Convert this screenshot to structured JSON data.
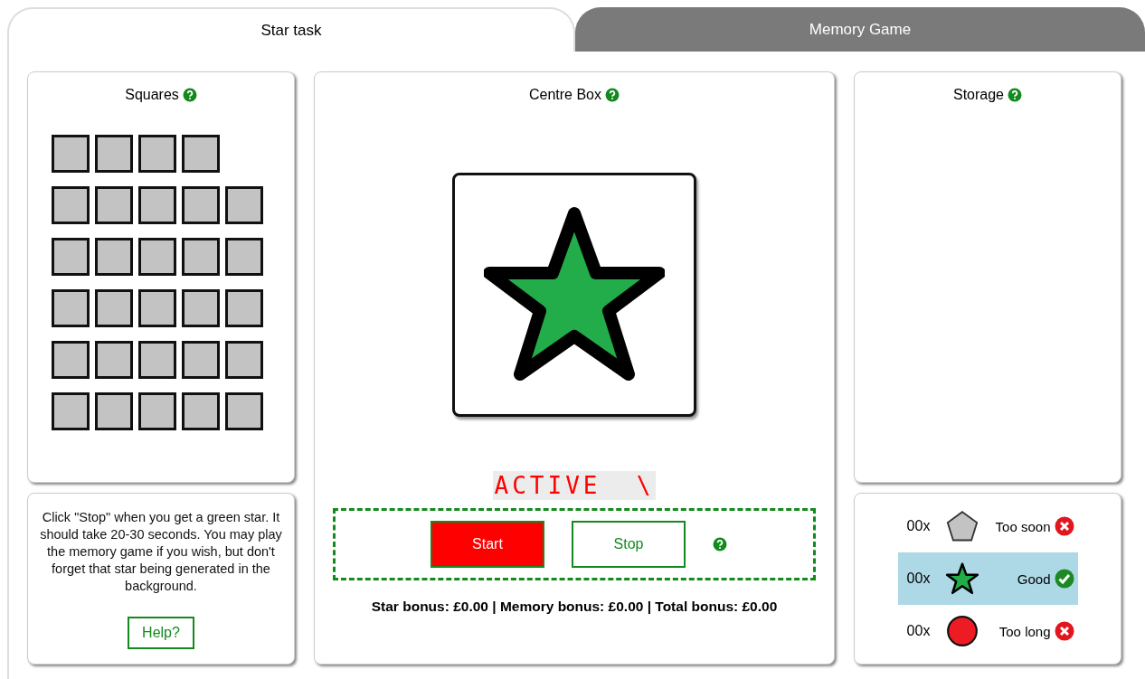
{
  "tabs": [
    {
      "label": "Star task",
      "selected": true
    },
    {
      "label": "Memory Game",
      "selected": false
    }
  ],
  "squares_panel": {
    "title": "Squares",
    "rows": [
      {
        "squares": [
          {
            "filled": true
          },
          {
            "filled": true
          },
          {
            "filled": true
          },
          {
            "filled": true
          }
        ]
      },
      {
        "squares": [
          {
            "filled": true
          },
          {
            "filled": true
          },
          {
            "filled": true
          },
          {
            "filled": true
          },
          {
            "filled": true
          }
        ]
      },
      {
        "squares": [
          {
            "filled": true
          },
          {
            "filled": true
          },
          {
            "filled": true
          },
          {
            "filled": true
          },
          {
            "filled": true
          }
        ]
      },
      {
        "squares": [
          {
            "filled": true
          },
          {
            "filled": true
          },
          {
            "filled": true
          },
          {
            "filled": true
          },
          {
            "filled": true
          }
        ]
      },
      {
        "squares": [
          {
            "filled": true
          },
          {
            "filled": true
          },
          {
            "filled": true
          },
          {
            "filled": true
          },
          {
            "filled": true
          }
        ]
      },
      {
        "squares": [
          {
            "filled": true
          },
          {
            "filled": true
          },
          {
            "filled": true
          },
          {
            "filled": true
          },
          {
            "filled": true
          }
        ]
      }
    ]
  },
  "instructions": {
    "text": "Click \"Stop\" when you get a green star. It should take 20-30 seconds. You may play the memory game if you wish, but don't forget that star being generated in the background.",
    "button": "Help?"
  },
  "centre_box": {
    "title": "Centre Box",
    "display": "ACTIVE  \\",
    "start_button": "Start",
    "stop_button": "Stop",
    "bonus": "Star bonus: £0.00 | Memory bonus: £0.00 | Total bonus: £0.00"
  },
  "storage": {
    "title": "Storage"
  },
  "results": [
    {
      "count": "00x",
      "kind": "pentagon",
      "label": "Too soon",
      "correct": false,
      "selected": false
    },
    {
      "count": "00x",
      "kind": "star",
      "label": "Good",
      "correct": true,
      "selected": true
    },
    {
      "count": "00x",
      "kind": "circle",
      "label": "Too long",
      "correct": false,
      "selected": false
    }
  ]
}
